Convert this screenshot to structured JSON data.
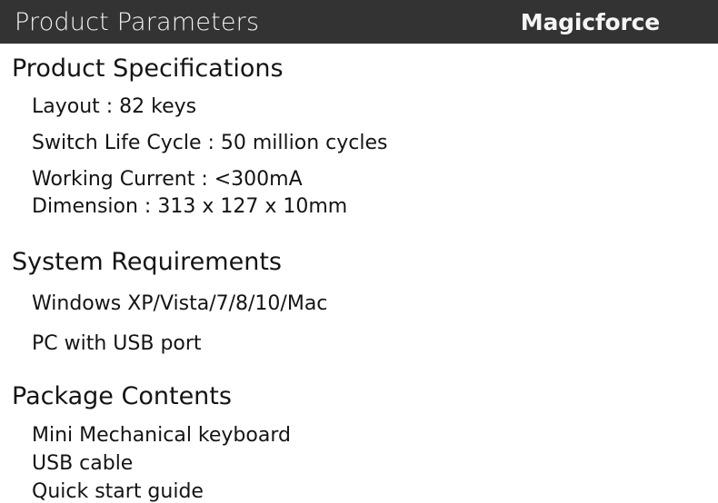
{
  "header": {
    "title": "Product Parameters",
    "brand": "Magicforce",
    "background_color": "#333333",
    "text_color": "#f2f2f2"
  },
  "sections": [
    {
      "heading": "Product Specifications",
      "items": [
        "Layout : 82 keys",
        "Switch Life Cycle : 50 million cycles",
        "Working Current : <300mA",
        "Dimension : 313 x 127 x 10mm"
      ]
    },
    {
      "heading": "System Requirements",
      "items": [
        "Windows XP/Vista/7/8/10/Mac",
        "PC with USB port"
      ]
    },
    {
      "heading": "Package Contents",
      "items": [
        "Mini Mechanical keyboard",
        "USB cable",
        "Quick start guide"
      ]
    }
  ]
}
